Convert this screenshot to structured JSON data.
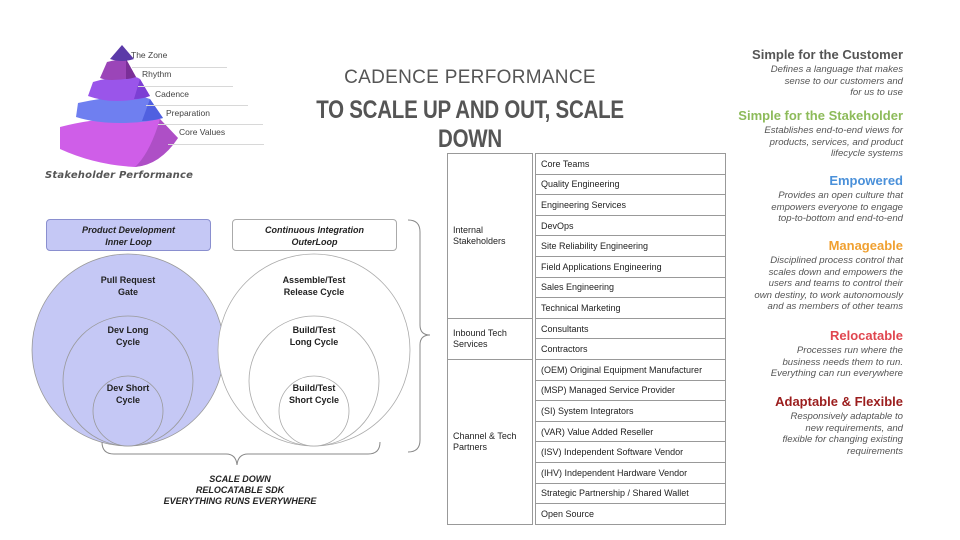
{
  "pyramid": {
    "levels": [
      {
        "label": "The Zone",
        "color": "#5b3aa8"
      },
      {
        "label": "Rhythm",
        "color": "#9b45b8"
      },
      {
        "label": "Cadence",
        "color": "#9a55ea"
      },
      {
        "label": "Preparation",
        "color": "#6f7ff0"
      },
      {
        "label": "Core Values",
        "color": "#cf5ee8"
      }
    ],
    "caption": "Stakeholder Performance"
  },
  "header": {
    "title": "CADENCE PERFORMANCE",
    "subtitle": "TO SCALE UP AND OUT, SCALE DOWN"
  },
  "loops": {
    "inner": {
      "title_line1": "Product Development",
      "title_line2": "Inner Loop",
      "fill_color": "#c5c8f5",
      "circles": [
        {
          "line1": "Pull Request",
          "line2": "Gate"
        },
        {
          "line1": "Dev Long",
          "line2": "Cycle"
        },
        {
          "line1": "Dev Short",
          "line2": "Cycle"
        }
      ]
    },
    "outer": {
      "title_line1": "Continuous Integration",
      "title_line2": "OuterLoop",
      "circles": [
        {
          "line1": "Assemble/Test",
          "line2": "Release Cycle"
        },
        {
          "line1": "Build/Test",
          "line2": "Long Cycle"
        },
        {
          "line1": "Build/Test",
          "line2": "Short Cycle"
        }
      ]
    },
    "bottom_lines": [
      "SCALE DOWN",
      "RELOCATABLE SDK",
      "EVERYTHING RUNS EVERYWHERE"
    ]
  },
  "stakeholders": {
    "groups": [
      {
        "name_line1": "Internal",
        "name_line2": "Stakeholders",
        "items": [
          "Core Teams",
          "Quality Engineering",
          "Engineering Services",
          "DevOps",
          "Site Reliability Engineering",
          "Field Applications  Engineering",
          "Sales Engineering",
          "Technical Marketing"
        ]
      },
      {
        "name_line1": "Inbound Tech",
        "name_line2": "Services",
        "items": [
          "Consultants",
          "Contractors"
        ]
      },
      {
        "name_line1": "Channel & Tech",
        "name_line2": "Partners",
        "items": [
          "(OEM) Original Equipment Manufacturer",
          "(MSP) Managed Service Provider",
          "(SI) System Integrators",
          "(VAR) Value Added Reseller",
          "(ISV) Independent Software Vendor",
          "(IHV) Independent Hardware Vendor",
          "Strategic Partnership / Shared Wallet",
          "Open Source"
        ]
      }
    ]
  },
  "principles": [
    {
      "title": "Simple for the Customer",
      "color": "#555555",
      "desc": [
        "Defines a language that makes",
        "sense to our customers and",
        "for us to use"
      ]
    },
    {
      "title": "Simple for the Stakeholder",
      "color": "#8dbb5a",
      "desc": [
        "Establishes end-to-end views for",
        "products, services, and product",
        "lifecycle  systems"
      ]
    },
    {
      "title": "Empowered",
      "color": "#4a90d9",
      "desc": [
        "Provides an open culture that",
        "empowers everyone to engage",
        "top-to-bottom and end-to-end"
      ]
    },
    {
      "title": "Manageable",
      "color": "#f0a030",
      "desc": [
        "Disciplined process control that",
        "scales down and empowers the",
        "users and teams to control their",
        "own destiny, to work autonomously",
        "and as members of other teams"
      ]
    },
    {
      "title": "Relocatable",
      "color": "#e0464f",
      "desc": [
        "Processes run where the",
        "business needs them to run.",
        "Everything can run everywhere"
      ]
    },
    {
      "title": "Adaptable & Flexible",
      "color": "#9b1d1d",
      "desc": [
        "Responsively adaptable to",
        "new requirements, and",
        "flexible for changing  existing",
        "requirements"
      ]
    }
  ]
}
